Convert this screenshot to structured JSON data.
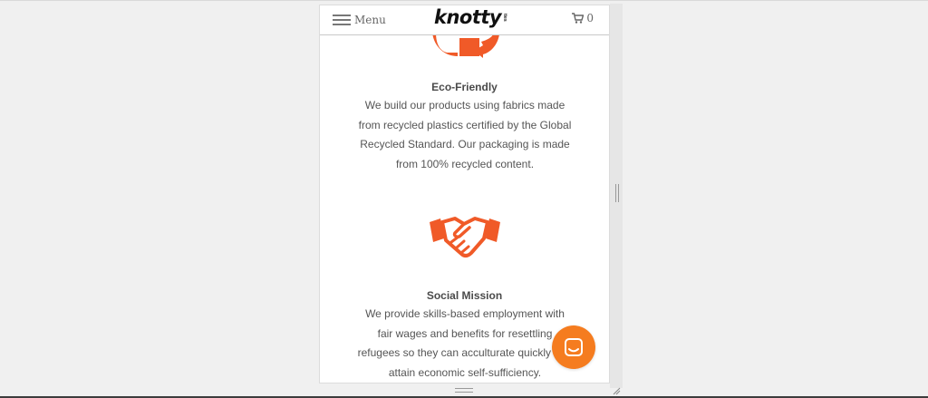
{
  "header": {
    "menu_label": "Menu",
    "logo_text": "knotty",
    "logo_tag": "ties",
    "cart_count": "0"
  },
  "sections": [
    {
      "icon": "recycle-icon",
      "title": "Eco-Friendly",
      "lines": [
        "We build our products using fabrics made",
        "from recycled plastics certified by the Global",
        "Recycled Standard. Our packaging is made",
        "from 100% recycled content."
      ]
    },
    {
      "icon": "handshake-icon",
      "title": "Social Mission",
      "lines": [
        "We provide skills-based employment with",
        "fair wages and benefits for resettling",
        "refugees so they can acculturate quickly and",
        "attain economic self-sufficiency."
      ]
    }
  ],
  "colors": {
    "accent": "#f05a28",
    "chat": "#f57c1f",
    "text": "#555555"
  }
}
